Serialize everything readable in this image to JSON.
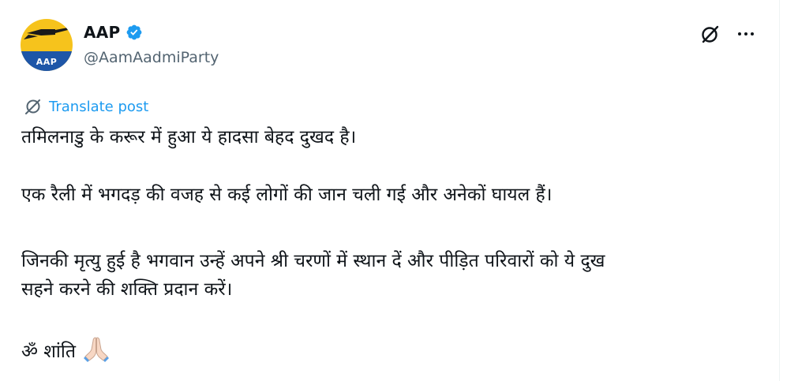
{
  "account": {
    "display_name": "AAP",
    "handle": "@AamAadmiParty",
    "avatar_text": "AAP",
    "verified": true
  },
  "icons": {
    "avatar": "aap-broom-logo",
    "verified": "verified-badge-icon",
    "grok": "grok-icon",
    "more": "more-options-icon",
    "translate": "translate-icon",
    "emoji": "folded-hands-emoji"
  },
  "colors": {
    "accent": "#1d9bf0",
    "text": "#0f1419",
    "muted": "#536471",
    "avatar_yellow": "#f6c31c",
    "avatar_blue": "#1e56a8"
  },
  "translate": {
    "label": "Translate post"
  },
  "tweet": {
    "line1": "तमिलनाडु के करूर में हुआ ये हादसा बेहद दुखद है।",
    "line2": "एक रैली में भगदड़ की वजह से कई लोगों की जान चली गई और अनेकों घायल हैं।",
    "line3": "जिनकी मृत्यु हुई है भगवान उन्हें अपने श्री चरणों में स्थान दें और पीड़ित परिवारों को ये दुख",
    "line4": "सहने करने की शक्ति प्रदान करें।",
    "line5": "ॐ शांति"
  }
}
